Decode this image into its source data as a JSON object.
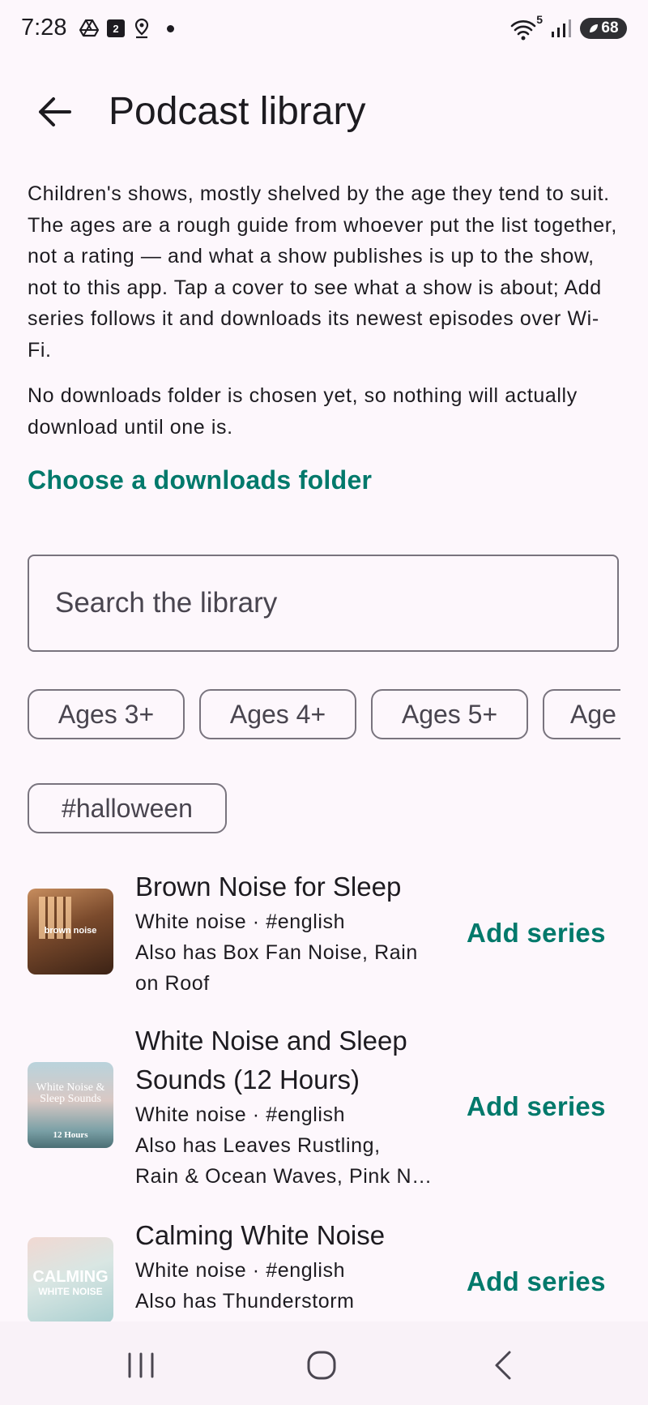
{
  "status": {
    "time": "7:28",
    "calendar_badge": "2",
    "wifi_badge": "5",
    "battery": "68"
  },
  "appbar": {
    "title": "Podcast library"
  },
  "intro": {
    "description": "Children's shows, mostly shelved by the age they tend to suit. The ages are a rough guide from whoever put the list together, not a rating — and what a show publishes is up to the show, not to this app. Tap a cover to see what a show is about; Add series follows it and downloads its newest episodes over Wi-Fi.",
    "notice": "No downloads folder is chosen yet, so nothing will actually download until one is.",
    "choose_folder": "Choose a downloads folder"
  },
  "search": {
    "placeholder": "Search the library"
  },
  "chips": [
    "Ages 3+",
    "Ages 4+",
    "Ages 5+",
    "Age",
    "#halloween"
  ],
  "items": [
    {
      "title": "Brown Noise for Sleep",
      "meta": "White noise · #english",
      "also_1": "Also has Box Fan Noise, Rain",
      "also_2": "on Roof",
      "cover_text": "brown noise",
      "action": "Add series"
    },
    {
      "title_1": "White Noise and Sleep",
      "title_2": "Sounds (12 Hours)",
      "meta": "White noise · #english",
      "also_1": "Also has Leaves Rustling,",
      "also_2": "Rain & Ocean Waves, Pink N…",
      "cover_text_1": "White Noise &",
      "cover_text_2": "Sleep Sounds",
      "cover_text_3": "12 Hours",
      "action": "Add series"
    },
    {
      "title": "Calming White Noise",
      "meta": "White noise · #english",
      "also_1": "Also has Thunderstorm",
      "cover_text_1": "CALMING",
      "cover_text_2": "WHITE NOISE",
      "action": "Add series"
    }
  ],
  "colors": {
    "accent": "#00796b",
    "background": "#fdf7fc",
    "outline": "#79747e"
  },
  "icons": [
    "back-arrow-icon",
    "recents-icon",
    "home-icon",
    "back-icon"
  ]
}
